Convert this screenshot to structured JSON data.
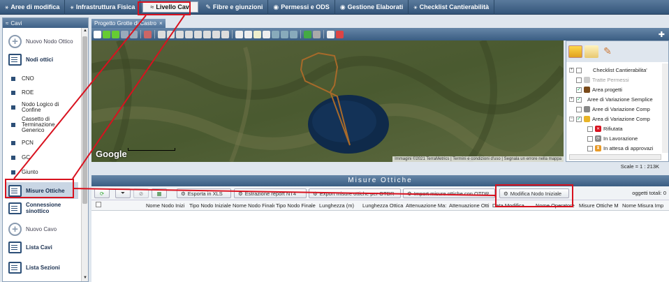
{
  "nav": [
    {
      "label": "Aree di modifica",
      "icon": "hierarchy-icon"
    },
    {
      "label": "Infrastruttura Fisica",
      "icon": "hierarchy-icon"
    },
    {
      "label": "Livello Cavi",
      "icon": "cable-icon"
    },
    {
      "label": "Fibre e giunzioni",
      "icon": "splice-icon"
    },
    {
      "label": "Permessi e ODS",
      "icon": "circle-icon"
    },
    {
      "label": "Gestione Elaborati",
      "icon": "circle-icon"
    },
    {
      "label": "Checklist Cantierabilità",
      "icon": "hierarchy-icon"
    }
  ],
  "sidebar": {
    "title": "Cavi",
    "items": [
      {
        "label": "Nuovo Nodo Ottico",
        "kind": "plus"
      },
      {
        "label": "Nodi ottici",
        "kind": "list"
      },
      {
        "label": "CNO",
        "kind": "square"
      },
      {
        "label": "ROE",
        "kind": "square"
      },
      {
        "label": "Nodo Logico di Confine",
        "kind": "square"
      },
      {
        "label": "Cassetto di Terminazione Generico",
        "kind": "square"
      },
      {
        "label": "PCN",
        "kind": "square"
      },
      {
        "label": "GC",
        "kind": "square"
      },
      {
        "label": "Giunto",
        "kind": "square"
      },
      {
        "label": "Misure Ottiche",
        "kind": "list"
      },
      {
        "label": "Connessione sinottico",
        "kind": "list"
      },
      {
        "label": "Nuovo Cavo",
        "kind": "plus"
      },
      {
        "label": "Lista Cavi",
        "kind": "list"
      },
      {
        "label": "Lista Sezioni",
        "kind": "list"
      }
    ]
  },
  "map": {
    "tab_label": "Progetto Grotte di Castro",
    "google_label": "Google",
    "credits": "Immagini ©2021 TerraMetrics | Termini e condizioni d'uso | Segnala un errore nella mappa"
  },
  "layers": {
    "items": [
      {
        "label": "Checklist Cantierabilita'",
        "checked": false,
        "color": ""
      },
      {
        "label": "Tratte Permessi",
        "checked": false,
        "color": "#bbbbbb"
      },
      {
        "label": "Area progetti",
        "checked": true,
        "color": "#7a4a1a"
      },
      {
        "label": "Aree di Variazione Semplice",
        "checked": true,
        "color": ""
      },
      {
        "label": "Aree di Variazione Comp",
        "checked": false,
        "color": "#888888"
      },
      {
        "label": "Area di Variazione Comp",
        "checked": true,
        "color": "#e8b428"
      },
      {
        "label": "Rifiutata",
        "checked": false,
        "color": "#d8121f"
      },
      {
        "label": "In Lavorazione",
        "checked": false,
        "color": "#888888"
      },
      {
        "label": "In attesa di approvazi",
        "checked": false,
        "color": "#e89a28"
      }
    ]
  },
  "scale_text": "Scale = 1 : 213K",
  "panel": {
    "title": "Misure Ottiche",
    "buttons": [
      "Esporta in XLS",
      "Estrazione report NT4",
      "Export misure ottiche per OTDR",
      "Import misure ottiche con OTDR",
      "Modifica Nodo Iniziale"
    ],
    "totals": "oggetti totali: 0",
    "columns": [
      "Nome Nodo Inizi",
      "Tipo Nodo Iniziale",
      "Nome Nodo Finale",
      "Tipo Nodo Finale",
      "Lunghezza (m)",
      "Lunghezza Ottica",
      "Attenuazione Ma:",
      "Attenuazione Otti",
      "Data Modifica",
      "Nome Operatore",
      "Misure Ottiche M",
      "Nome Misura Imp"
    ]
  },
  "colors": {
    "highlight": "#d8121f",
    "header": "#3a5d82"
  }
}
